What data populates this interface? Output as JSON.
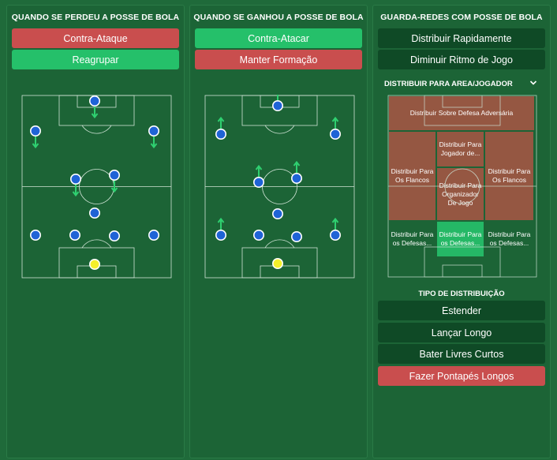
{
  "panels": {
    "lost": {
      "title": "QUANDO SE PERDEU A POSSE DE BOLA",
      "options": [
        {
          "label": "Contra-Ataque",
          "state": "red"
        },
        {
          "label": "Reagrupar",
          "state": "green"
        }
      ]
    },
    "won": {
      "title": "QUANDO SE GANHOU A POSSE DE BOLA",
      "options": [
        {
          "label": "Contra-Atacar",
          "state": "green"
        },
        {
          "label": "Manter Formação",
          "state": "red"
        }
      ]
    },
    "gk": {
      "title": "GUARDA-REDES COM POSSE DE BOLA",
      "options": [
        {
          "label": "Distribuir Rapidamente",
          "state": "dark"
        },
        {
          "label": "Diminuir Ritmo de Jogo",
          "state": "dark"
        }
      ],
      "area_title": "DISTRIBUIR PARA AREA/JOGADOR",
      "zones": {
        "top": "Distribuir Sobre Defesa Adversária",
        "mid_left": "Distribuir Para Os Flancos",
        "mid_center_top": "Distribuir Para Jogador de...",
        "mid_center_bottom": "Distribuir Para Organizador De Jogo",
        "mid_right": "Distribuir Para Os Flancos",
        "low_left": "Distribuir Para os Defesas...",
        "low_center": "Distribuir Para os Defesas...",
        "low_right": "Distribuir Para os Defesas..."
      },
      "type_title": "TIPO DE DISTRIBUIÇÃO",
      "type_options": [
        {
          "label": "Estender",
          "state": "dark"
        },
        {
          "label": "Lançar Longo",
          "state": "dark"
        },
        {
          "label": "Bater Livres Curtos",
          "state": "dark"
        },
        {
          "label": "Fazer Pontapés Longos",
          "state": "red"
        }
      ]
    }
  },
  "colors": {
    "red": "#c94e4e",
    "green": "#25c06a",
    "dark": "#0f4a26",
    "player": "#1f63d6",
    "goalkeeper": "#f5f02a",
    "arrow": "#2fd070"
  }
}
